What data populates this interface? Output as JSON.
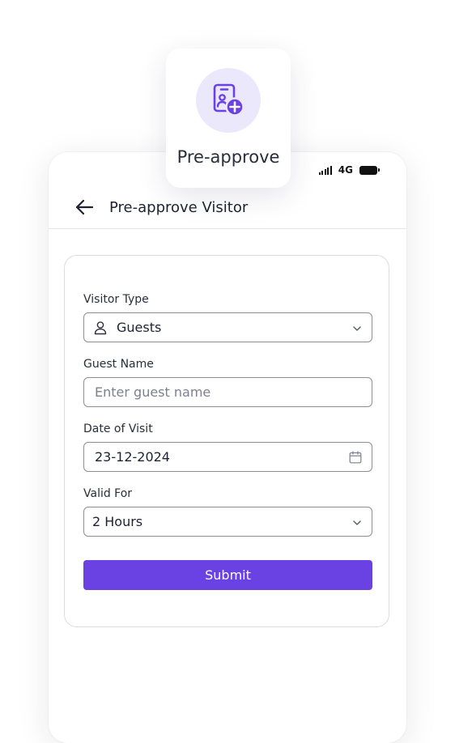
{
  "feature_badge": {
    "label": "Pre-approve",
    "icon": "visitor-add-icon"
  },
  "status_bar": {
    "network": "4G"
  },
  "header": {
    "title": "Pre-approve Visitor"
  },
  "form": {
    "visitor_type": {
      "label": "Visitor Type",
      "value": "Guests"
    },
    "guest_name": {
      "label": "Guest Name",
      "value": "",
      "placeholder": "Enter guest name"
    },
    "date_of_visit": {
      "label": "Date of Visit",
      "value": "23-12-2024"
    },
    "valid_for": {
      "label": "Valid For",
      "value": "2 Hours"
    },
    "submit_label": "Submit"
  },
  "colors": {
    "accent": "#6a42e3",
    "badge_bg": "#ece8fb"
  }
}
